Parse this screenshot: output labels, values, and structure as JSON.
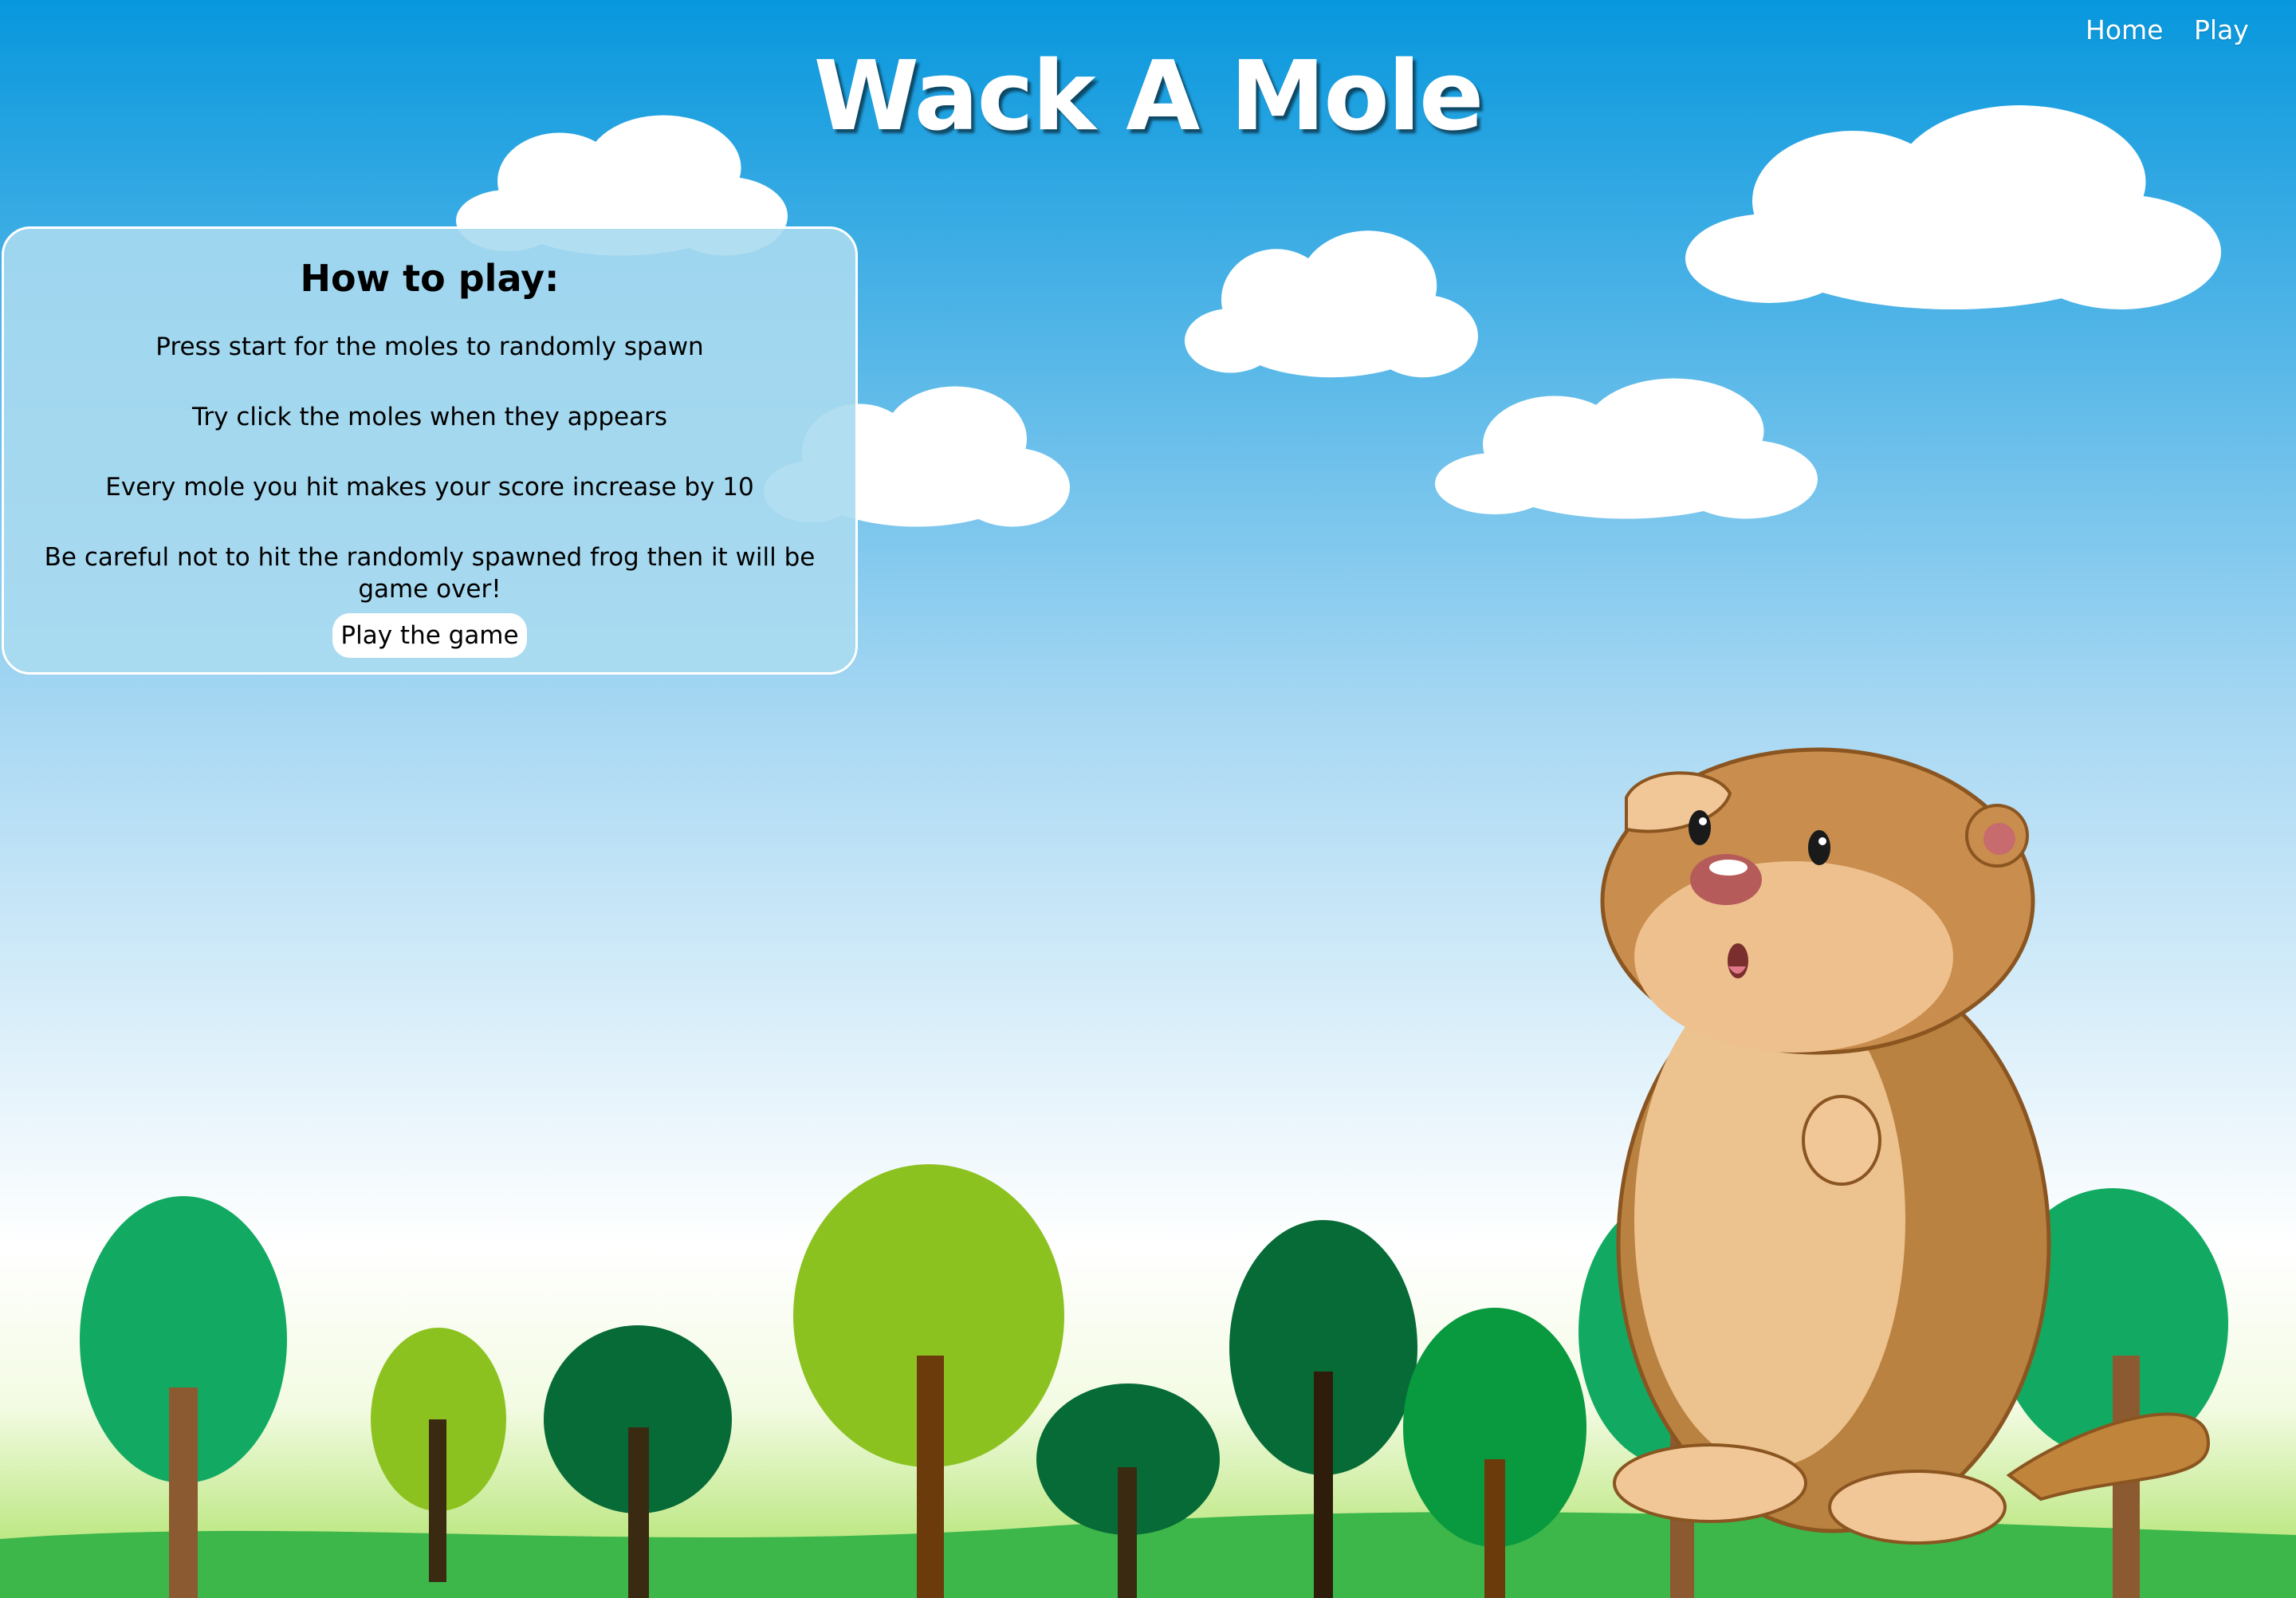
{
  "nav": {
    "home_label": "Home",
    "play_label": "Play"
  },
  "header": {
    "title": "Wack A Mole"
  },
  "howto": {
    "title": "How to play:",
    "lines": [
      "Press start for the moles to randomly spawn",
      "Try click the moles when they appears",
      "Every mole you hit makes your score increase by 10",
      "Be careful not to hit the randomly spawned frog then it will be game over!"
    ],
    "button_label": "Play the game"
  },
  "colors": {
    "sky_top": "#0797dd",
    "sky_bottom": "#ffffff",
    "grass": "#3db64a",
    "panel_bg": "#aadaf0",
    "title_text": "#ffffff"
  },
  "icons": [
    "cloud-icon",
    "tree-icon",
    "mole-illustration"
  ]
}
